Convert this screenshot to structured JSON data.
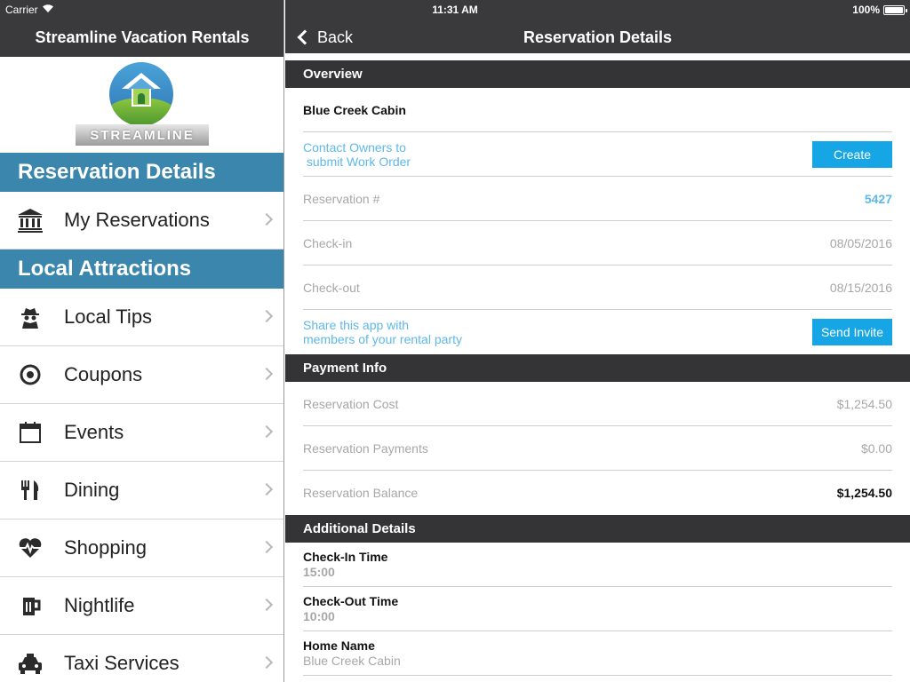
{
  "status_bar": {
    "carrier": "Carrier",
    "time": "11:31 AM",
    "battery": "100%"
  },
  "sidebar": {
    "title": "Streamline Vacation Rentals",
    "logo_text": "STREAMLINE",
    "sections": [
      {
        "header": "Reservation Details",
        "items": [
          {
            "label": "My Reservations",
            "icon": "bank-icon"
          }
        ]
      },
      {
        "header": "Local Attractions",
        "items": [
          {
            "label": "Local Tips",
            "icon": "spy-icon"
          },
          {
            "label": "Coupons",
            "icon": "target-icon"
          },
          {
            "label": "Events",
            "icon": "calendar-icon"
          },
          {
            "label": "Dining",
            "icon": "fork-knife-icon"
          },
          {
            "label": "Shopping",
            "icon": "heartbeat-icon"
          },
          {
            "label": "Nightlife",
            "icon": "beer-icon"
          },
          {
            "label": "Taxi Services",
            "icon": "taxi-icon"
          }
        ]
      }
    ]
  },
  "detail": {
    "back_label": "Back",
    "title": "Reservation Details",
    "overview": {
      "header": "Overview",
      "property_name": "Blue Creek Cabin",
      "contact_owners_line1": "Contact Owners to",
      "contact_owners_line2": " submit Work Order",
      "create_label": "Create",
      "reservation_label": "Reservation #",
      "reservation_number": "5427",
      "checkin_label": "Check-in",
      "checkin_value": "08/05/2016",
      "checkout_label": "Check-out",
      "checkout_value": "08/15/2016",
      "share_line1": "Share this app with",
      "share_line2": "members of your rental party",
      "send_invite_label": "Send Invite"
    },
    "payment": {
      "header": "Payment Info",
      "cost_label": "Reservation Cost",
      "cost_value": "$1,254.50",
      "payments_label": "Reservation Payments",
      "payments_value": "$0.00",
      "balance_label": "Reservation Balance",
      "balance_value": "$1,254.50"
    },
    "additional": {
      "header": "Additional Details",
      "checkin_time_label": "Check-In Time",
      "checkin_time_value": "15:00",
      "checkout_time_label": "Check-Out Time",
      "checkout_time_value": "10:00",
      "home_name_label": "Home Name",
      "home_name_value": "Blue Creek Cabin"
    }
  },
  "colors": {
    "header_bg": "#3a3a3c",
    "section_blue": "#3a86ad",
    "accent_blue": "#16a6e5",
    "link_blue": "#5eb8e8"
  }
}
